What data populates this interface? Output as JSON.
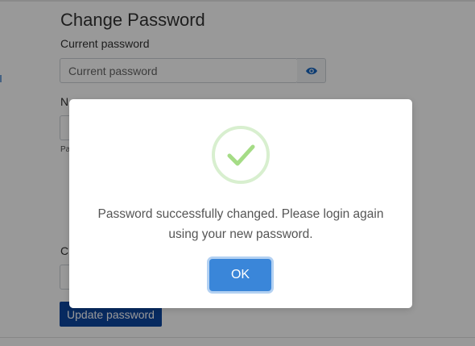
{
  "form": {
    "title": "Change Password",
    "current_label": "Current password",
    "current_placeholder": "Current password",
    "new_label_partial": "N",
    "new_label_partial_end": "",
    "hint_partial": "Pa",
    "confirm_label_partial": "C",
    "update_button": "Update password"
  },
  "dialog": {
    "message": "Password successfully changed. Please login again using your new password.",
    "ok_label": "OK"
  },
  "colors": {
    "primary": "#0d47a1",
    "ok_button": "#3a86d9",
    "success_ring": "#d8efcf",
    "success_check": "#a5dc86"
  }
}
